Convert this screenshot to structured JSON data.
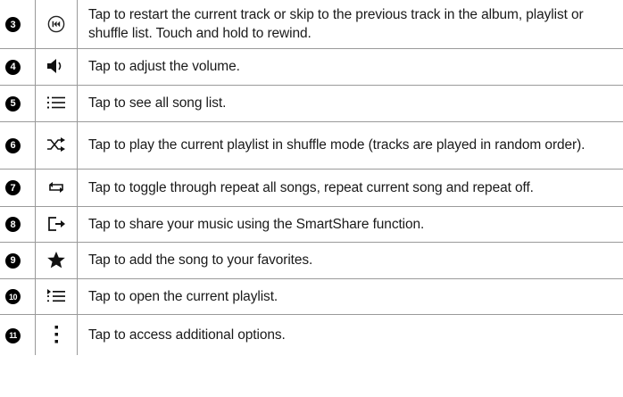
{
  "rows": [
    {
      "num": "3",
      "icon": "previous-track-icon",
      "desc": "Tap to restart the current track or skip to the previous track in the album, playlist or shuffle list. Touch and hold to rewind."
    },
    {
      "num": "4",
      "icon": "volume-icon",
      "desc": "Tap to adjust the volume."
    },
    {
      "num": "5",
      "icon": "song-list-icon",
      "desc": "Tap to see all song list."
    },
    {
      "num": "6",
      "icon": "shuffle-icon",
      "desc": "Tap to play the current playlist in shuffle mode (tracks are played in random order)."
    },
    {
      "num": "7",
      "icon": "repeat-icon",
      "desc": "Tap to toggle through repeat all songs, repeat current song and repeat off."
    },
    {
      "num": "8",
      "icon": "share-icon",
      "desc": "Tap to share your music using the SmartShare function."
    },
    {
      "num": "9",
      "icon": "star-icon",
      "desc": "Tap to add the song to your favorites."
    },
    {
      "num": "10",
      "icon": "playlist-icon",
      "desc": "Tap to open the current playlist."
    },
    {
      "num": "11",
      "icon": "more-options-icon",
      "desc": "Tap to access additional options."
    }
  ]
}
